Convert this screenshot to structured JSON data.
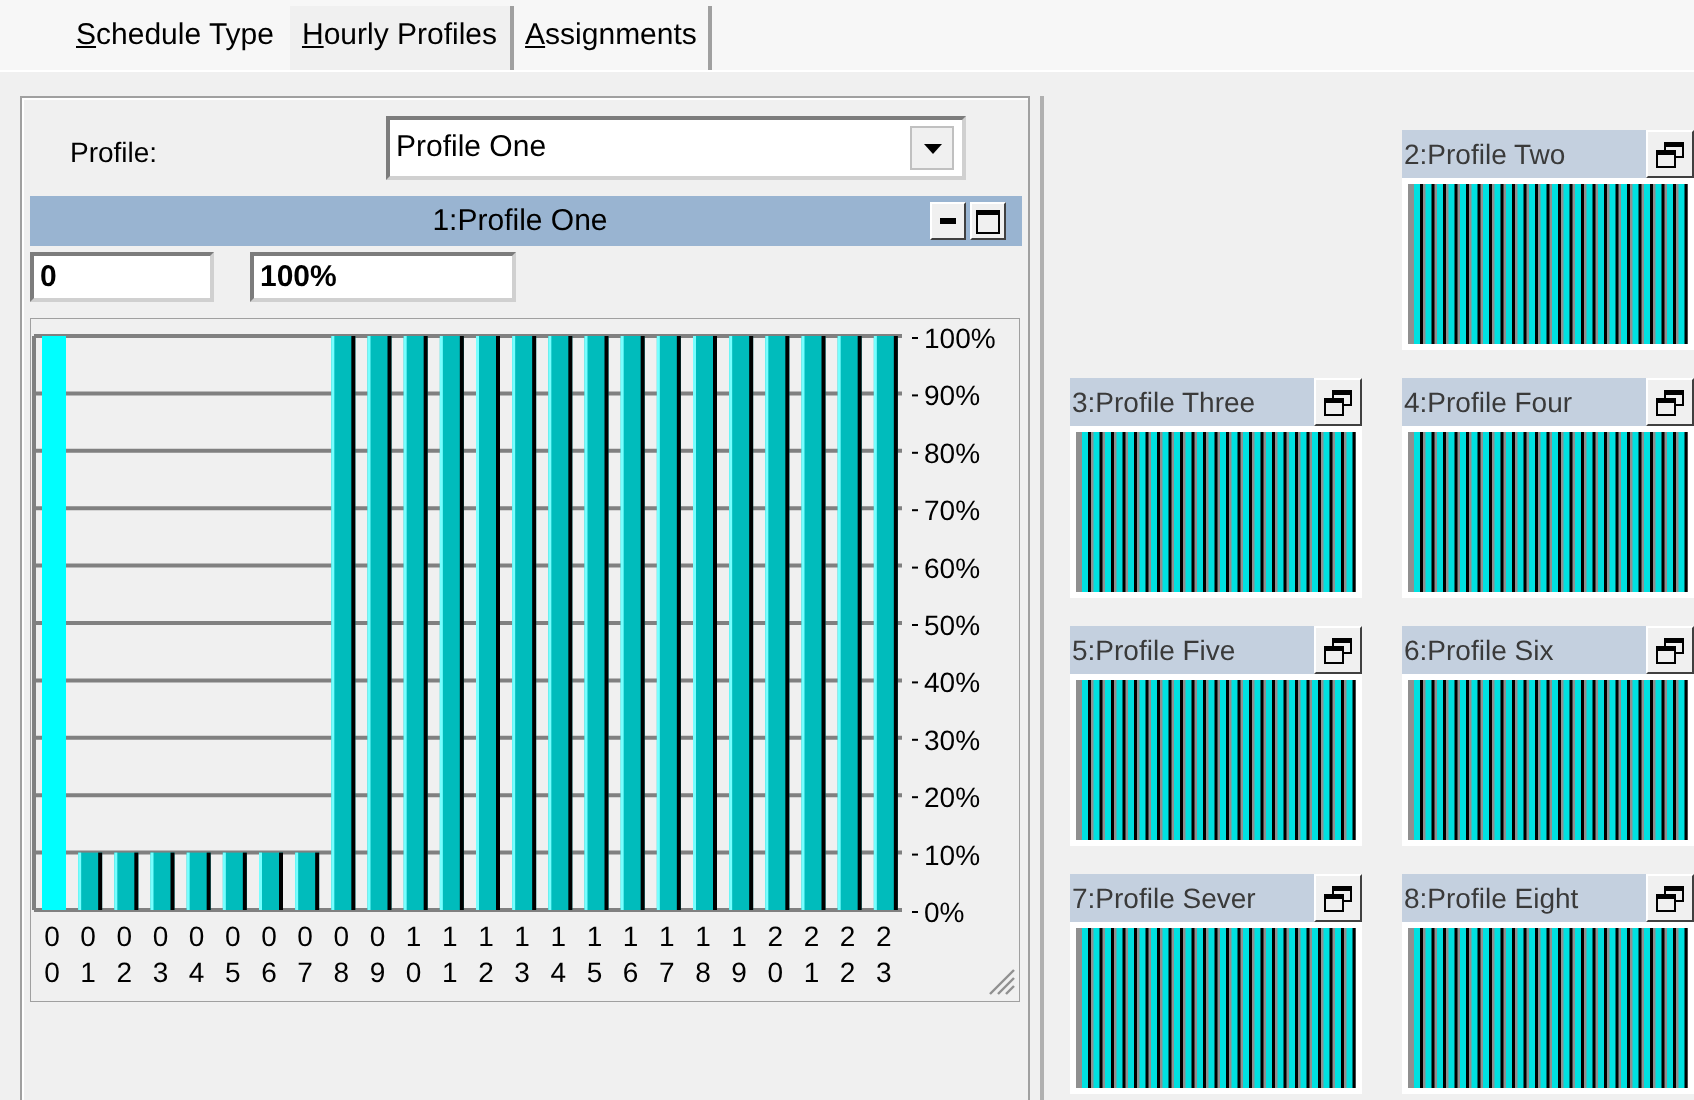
{
  "tabs": [
    {
      "label": "Schedule Type",
      "underline_first_letter": true,
      "selected": false
    },
    {
      "label": "Hourly Profiles",
      "underline_first_letter": true,
      "selected": true
    },
    {
      "label": "Assignments",
      "underline_first_letter": true,
      "selected": false
    }
  ],
  "profile_selector": {
    "label": "Profile:",
    "value": "Profile One"
  },
  "main_profile": {
    "title": "1:Profile One",
    "range_fields": [
      {
        "value": "0"
      },
      {
        "value": "100%"
      }
    ],
    "hour_selected": [
      true,
      false,
      false,
      false,
      false,
      false,
      false,
      false,
      false,
      false,
      false,
      false,
      false,
      false,
      false,
      false,
      false,
      false,
      false,
      false,
      false,
      false,
      false,
      false
    ],
    "chart_data": {
      "type": "bar",
      "grid": true,
      "categories": [
        "00",
        "01",
        "02",
        "03",
        "04",
        "05",
        "06",
        "07",
        "08",
        "09",
        "10",
        "11",
        "12",
        "13",
        "14",
        "15",
        "16",
        "17",
        "18",
        "19",
        "20",
        "21",
        "22",
        "23"
      ],
      "values": [
        1,
        0.1,
        0.1,
        0.1,
        0.1,
        0.1,
        0.1,
        0.1,
        1,
        1,
        1,
        1,
        1,
        1,
        1,
        1,
        1,
        1,
        1,
        1,
        1,
        1,
        1,
        1
      ],
      "ylim": [
        0,
        1
      ],
      "yticks": [
        {
          "value": 1,
          "label": "100%"
        },
        {
          "value": 0.9,
          "label": "90%"
        },
        {
          "value": 0.8,
          "label": "80%"
        },
        {
          "value": 0.7,
          "label": "70%"
        },
        {
          "value": 0.6,
          "label": "60%"
        },
        {
          "value": 0.5,
          "label": "50%"
        },
        {
          "value": 0.4,
          "label": "40%"
        },
        {
          "value": 0.3,
          "label": "30%"
        },
        {
          "value": 0.2,
          "label": "20%"
        },
        {
          "value": 0.1,
          "label": "10%"
        },
        {
          "value": 0,
          "label": "0%"
        }
      ]
    }
  },
  "mini_profiles": [
    {
      "title": "2:Profile Two"
    },
    {
      "title": "3:Profile Three"
    },
    {
      "title": "4:Profile Four"
    },
    {
      "title": "5:Profile Five"
    },
    {
      "title": "6:Profile Six"
    },
    {
      "title": "7:Profile Sever"
    },
    {
      "title": "8:Profile Eight"
    }
  ]
}
